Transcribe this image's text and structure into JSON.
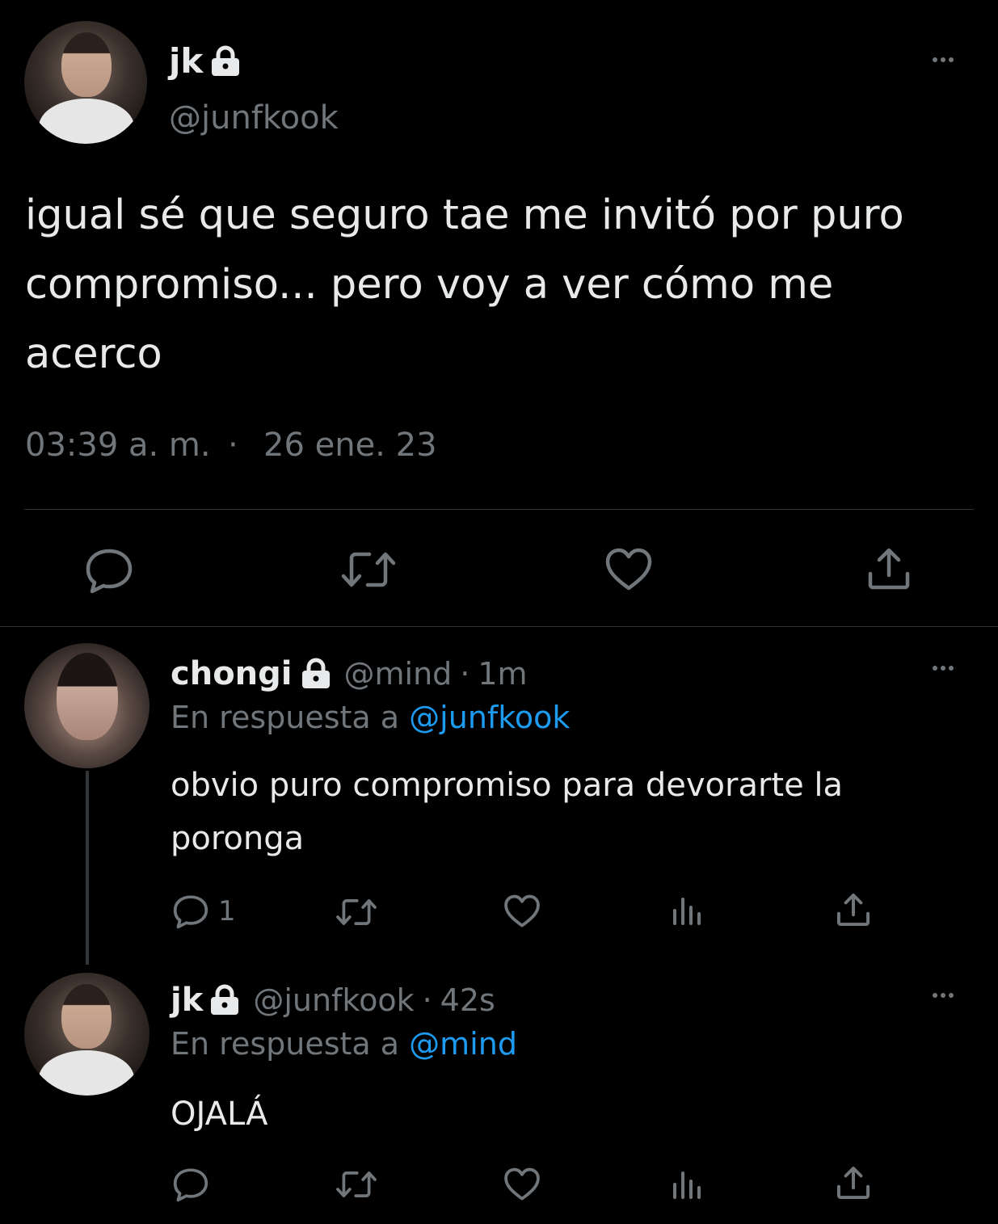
{
  "main_tweet": {
    "display_name": "jk",
    "handle": "@junfkook",
    "text": "igual sé que seguro tae me invitó por puro\ncompromiso... pero voy a ver cómo me\nacerco",
    "time": "03:39 a. m.",
    "separator": "·",
    "date": "26 ene. 23",
    "actions": [
      "reply-icon",
      "retweet-icon",
      "like-icon",
      "share-icon"
    ],
    "locked": true
  },
  "replies": [
    {
      "display_name": "chongi",
      "handle": "@mind",
      "dot": "·",
      "time": "1m",
      "reply_prefix": "En respuesta a",
      "reply_to": "@junfkook",
      "text": "obvio puro compromiso para devorarte la\nporonga",
      "reply_count": "1",
      "locked": true
    },
    {
      "display_name": "jk",
      "handle": "@junfkook",
      "dot": "·",
      "time": "42s",
      "reply_prefix": "En respuesta a",
      "reply_to": "@mind",
      "text": "OJALÁ",
      "reply_count": "",
      "locked": true
    }
  ],
  "colors": {
    "background": "#000000",
    "text": "#e7e9ea",
    "muted": "#71767b",
    "link": "#1d9bf0",
    "divider": "#2f3336"
  }
}
